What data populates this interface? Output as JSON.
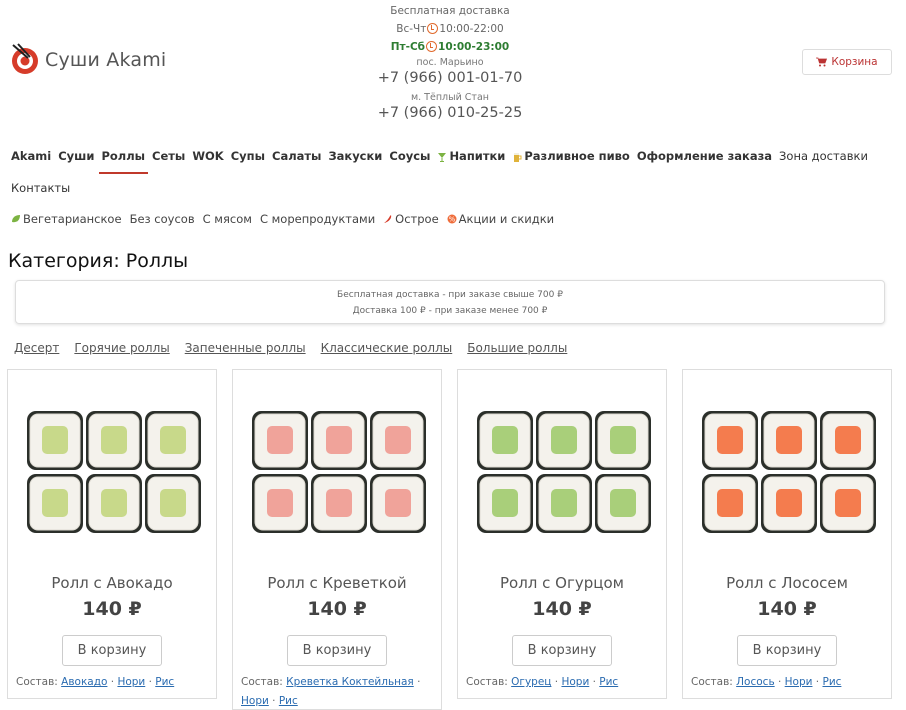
{
  "brand": {
    "name": "Суши Akami"
  },
  "hours": {
    "free_delivery": "Бесплатная доставка",
    "weekday_label": "Вс-Чт",
    "weekday_time": "10:00-22:00",
    "weekend_label": "Пт-Сб",
    "weekend_time": "10:00-23:00",
    "loc1": "пос. Марьино",
    "phone1": "+7 (966) 001-01-70",
    "loc2": "м. Тёплый Стан",
    "phone2": "+7 (966) 010-25-25"
  },
  "cart": {
    "label": "Корзина"
  },
  "nav": {
    "items": [
      "Akami",
      "Суши",
      "Роллы",
      "Сеты",
      "WOK",
      "Супы",
      "Салаты",
      "Закуски",
      "Соусы",
      "Напитки",
      "Разливное пиво",
      "Оформление заказа",
      "Зона доставки"
    ],
    "contacts": "Контакты"
  },
  "filters": [
    "Вегетарианское",
    "Без соусов",
    "С мясом",
    "С морепродуктами",
    "Острое",
    "Акции и скидки"
  ],
  "category": {
    "title": "Категория: Роллы"
  },
  "notice": {
    "line1": "Бесплатная доставка - при заказе свыше 700 ₽",
    "line2": "Доставка 100 ₽ - при заказе менее 700 ₽"
  },
  "subcategories": [
    "Десерт",
    "Горячие роллы",
    "Запеченные роллы",
    "Классические роллы",
    "Большие роллы"
  ],
  "products": [
    {
      "name": "Ролл с Авокадо",
      "price": "140 ₽",
      "button": "В корзину",
      "composition_label": "Состав:",
      "ingredients": [
        "Авокадо",
        "Нори",
        "Рис"
      ],
      "filling_color": "#c8d98a"
    },
    {
      "name": "Ролл с Креветкой",
      "price": "140 ₽",
      "button": "В корзину",
      "composition_label": "Состав:",
      "ingredients": [
        "Креветка Коктейльная",
        "Нори",
        "Рис"
      ],
      "filling_color": "#f0a39a"
    },
    {
      "name": "Ролл с Огурцом",
      "price": "140 ₽",
      "button": "В корзину",
      "composition_label": "Состав:",
      "ingredients": [
        "Огурец",
        "Нори",
        "Рис"
      ],
      "filling_color": "#a9cf7a"
    },
    {
      "name": "Ролл с Лососем",
      "price": "140 ₽",
      "button": "В корзину",
      "composition_label": "Состав:",
      "ingredients": [
        "Лосось",
        "Нори",
        "Рис"
      ],
      "filling_color": "#f47c4e"
    }
  ]
}
